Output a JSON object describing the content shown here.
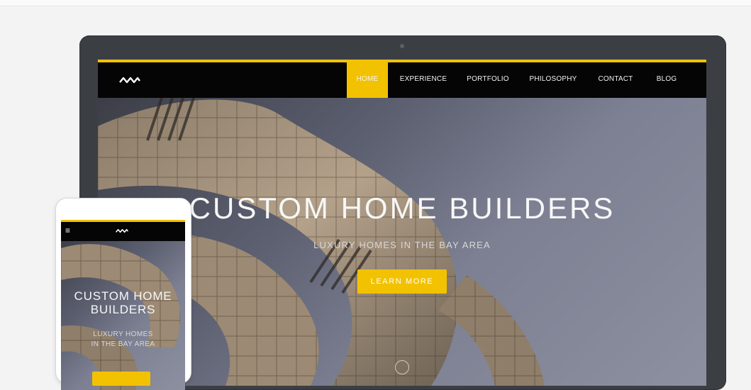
{
  "colors": {
    "accent": "#f2c200",
    "navbar": "#050505",
    "device_frame": "#3b3f44",
    "page_bg": "#f3f3f3"
  },
  "desktop": {
    "nav": {
      "logo_icon": "waves-logo-icon",
      "items": [
        "HOME",
        "EXPERIENCE",
        "PORTFOLIO",
        "PHILOSOPHY",
        "CONTACT",
        "BLOG"
      ],
      "active_index": 0
    },
    "hero": {
      "title": "CUSTOM HOME BUILDERS",
      "subtitle": "LUXURY HOMES IN THE BAY AREA",
      "button_label": "LEARN MORE",
      "scroll_icon": "chevron-down-circle-icon"
    }
  },
  "mobile": {
    "nav": {
      "menu_icon": "hamburger-icon",
      "menu_glyph": "≡",
      "logo_icon": "waves-logo-icon"
    },
    "hero": {
      "title_line1": "CUSTOM HOME",
      "title_line2": "BUILDERS",
      "subtitle_line1": "LUXURY HOMES",
      "subtitle_line2": "IN THE BAY AREA"
    }
  }
}
